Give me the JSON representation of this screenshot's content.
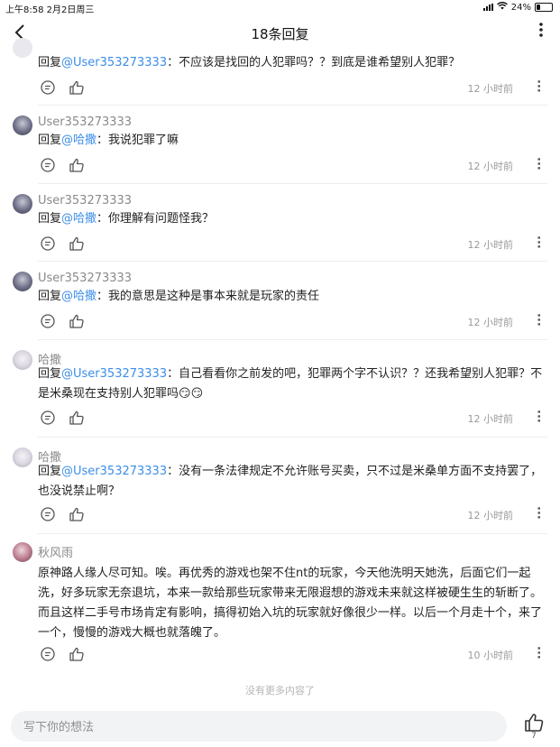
{
  "status_bar": {
    "time_date": "上午8:58  2月2日周三",
    "battery": "24%",
    "battery_level": 0.24
  },
  "header": {
    "title": "18条回复"
  },
  "comments": [
    {
      "user": "",
      "prefix": "回复",
      "mention": "@User353273333",
      "text": "：不应该是找回的人犯罪吗？？到底是谁希望别人犯罪？",
      "time": "12 小时前"
    },
    {
      "user": "User353273333",
      "prefix": "回复",
      "mention": "@哈撒",
      "text": "：我说犯罪了嘛",
      "time": "12 小时前"
    },
    {
      "user": "User353273333",
      "prefix": "回复",
      "mention": "@哈撒",
      "text": "：你理解有问题怪我？",
      "time": "12 小时前"
    },
    {
      "user": "User353273333",
      "prefix": "回复",
      "mention": "@哈撒",
      "text": "：我的意思是这种是事本来就是玩家的责任",
      "time": "12 小时前"
    },
    {
      "user": "哈撒",
      "prefix": "回复",
      "mention": "@User353273333",
      "text": "：自己看看你之前发的吧，犯罪两个字不认识？？还我希望别人犯罪？不是米桑现在支持别人犯罪吗",
      "emoji": "😏😏",
      "time": "12 小时前"
    },
    {
      "user": "哈撒",
      "prefix": "回复",
      "mention": "@User353273333",
      "text": "：没有一条法律规定不允许账号买卖，只不过是米桑单方面不支持罢了，也没说禁止啊？",
      "time": "12 小时前"
    },
    {
      "user": "秋风雨",
      "prefix": "",
      "mention": "",
      "text": "原神路人缘人尽可知。唉。再优秀的游戏也架不住nt的玩家，今天他洗明天她洗，后面它们一起洗，好多玩家无奈退坑，本来一款给那些玩家带来无限遐想的游戏未来就这样被硬生生的斩断了。而且这样二手号市场肯定有影响，搞得初始入坑的玩家就好像很少一样。以后一个月走十个，来了一个，慢慢的游戏大概也就落魄了。",
      "time": "10 小时前"
    }
  ],
  "footer": {
    "no_more": "没有更多内容了",
    "input_placeholder": "写下你的想法",
    "like_count": "7"
  }
}
